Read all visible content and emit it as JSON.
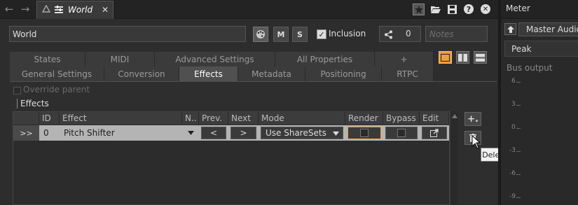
{
  "topbar": {
    "back_glyph": "←",
    "forward_glyph": "→",
    "tab_title": "World",
    "close_glyph": "✕",
    "icons": [
      "star-icon",
      "folder-open-icon",
      "save-icon",
      "help-icon",
      "close-window-icon"
    ]
  },
  "header": {
    "name_value": "World",
    "m_label": "M",
    "s_label": "S",
    "inclusion_label": "Inclusion",
    "share_count": "0",
    "notes_placeholder": "Notes"
  },
  "tabs_row1": [
    "States",
    "MIDI",
    "Advanced Settings",
    "All Properties",
    "+"
  ],
  "tabs_row2": [
    "General Settings",
    "Conversion",
    "Effects",
    "Metadata",
    "Positioning",
    "RTPC"
  ],
  "active_tab": "Effects",
  "override_parent_label": "Override parent",
  "section_title": "Effects",
  "table": {
    "headers": [
      "",
      "ID",
      "Effect",
      "N..",
      "Prev.",
      "Next",
      "Mode",
      "Render",
      "Bypass",
      "Edit"
    ],
    "rows": [
      {
        "expand": ">>",
        "id": "0",
        "effect": "Pitch Shifter",
        "prev": "<",
        "next": ">",
        "mode": "Use ShareSets"
      }
    ]
  },
  "side_buttons": {
    "add": "+.",
    "delete_tooltip": "Delete Effect(s)"
  },
  "meter": {
    "title": "Meter",
    "bus_name": "Master Audio",
    "mode": "Peak",
    "section": "Bus output",
    "ticks": [
      "6",
      "3",
      "0",
      "-3",
      "-6",
      "-9"
    ]
  },
  "colors": {
    "accent": "#e8a040",
    "bg": "#2d2d2d",
    "row_bg": "#b4b4b4"
  }
}
